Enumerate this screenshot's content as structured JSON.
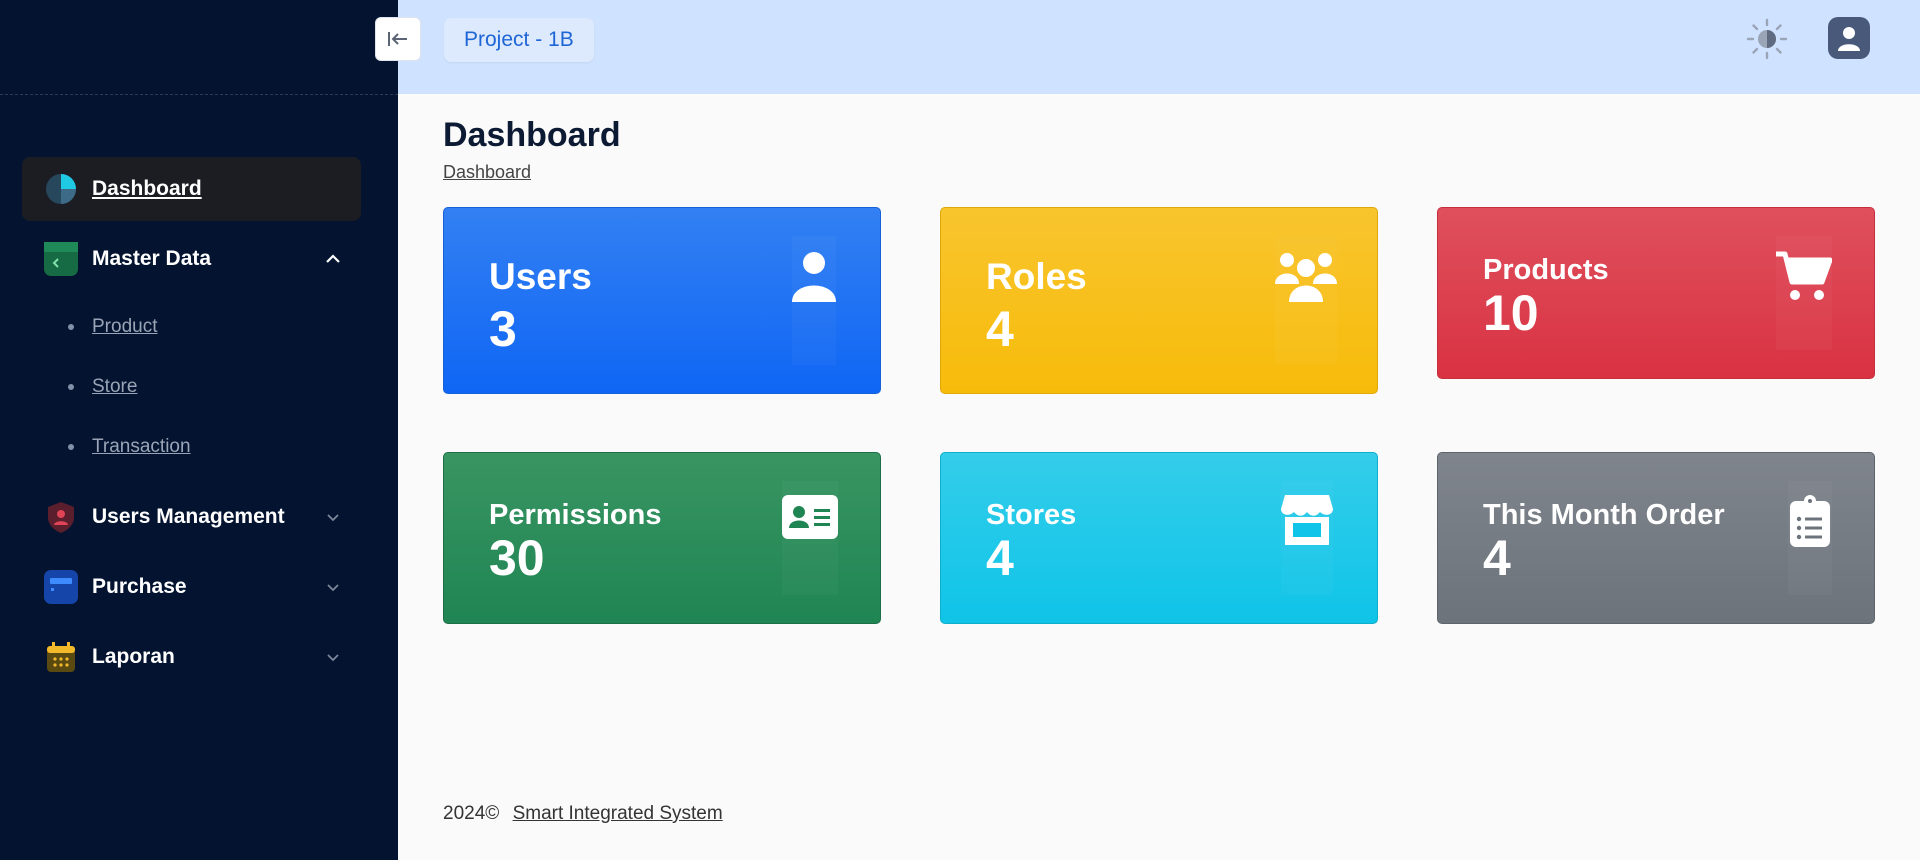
{
  "header": {
    "project_label": "Project - 1B"
  },
  "sidebar": {
    "items": [
      {
        "label": "Dashboard",
        "icon": "pie-chart-icon",
        "active": true
      },
      {
        "label": "Master Data",
        "icon": "folder-icon",
        "expanded": true,
        "children": [
          {
            "label": "Product"
          },
          {
            "label": "Store"
          },
          {
            "label": "Transaction"
          }
        ]
      },
      {
        "label": "Users Management",
        "icon": "user-shield-icon"
      },
      {
        "label": "Purchase",
        "icon": "card-icon"
      },
      {
        "label": "Laporan",
        "icon": "calendar-icon"
      }
    ]
  },
  "main": {
    "title": "Dashboard",
    "breadcrumb": "Dashboard"
  },
  "cards": [
    {
      "title": "Users",
      "value": "3",
      "icon": "user-icon",
      "color": "#0f66f4"
    },
    {
      "title": "Roles",
      "value": "4",
      "icon": "users-group-icon",
      "color": "#f7bb0a"
    },
    {
      "title": "Products",
      "value": "10",
      "icon": "cart-icon",
      "color": "#d93242"
    },
    {
      "title": "Permissions",
      "value": "30",
      "icon": "id-card-icon",
      "color": "#1f8553"
    },
    {
      "title": "Stores",
      "value": "4",
      "icon": "store-icon",
      "color": "#0fc4e8"
    },
    {
      "title": "This Month Order",
      "value": "4",
      "icon": "clipboard-list-icon",
      "color": "#6c737b"
    }
  ],
  "footer": {
    "year": "2024©",
    "link": "Smart Integrated System"
  }
}
